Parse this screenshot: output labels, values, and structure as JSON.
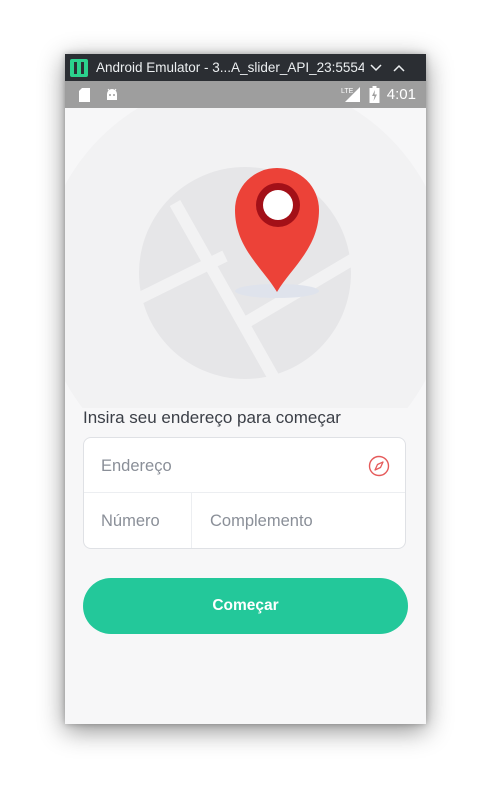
{
  "window": {
    "title": "Android Emulator - 3...A_slider_API_23:5554"
  },
  "statusbar": {
    "network": "LTE",
    "time": "4:01"
  },
  "form": {
    "prompt": "Insira seu endereço para começar",
    "address_placeholder": "Endereço",
    "number_placeholder": "Número",
    "complement_placeholder": "Complemento"
  },
  "actions": {
    "start_label": "Começar"
  },
  "colors": {
    "accent": "#23c89a",
    "pin": "#e8433a",
    "compass": "#e55a5a"
  }
}
